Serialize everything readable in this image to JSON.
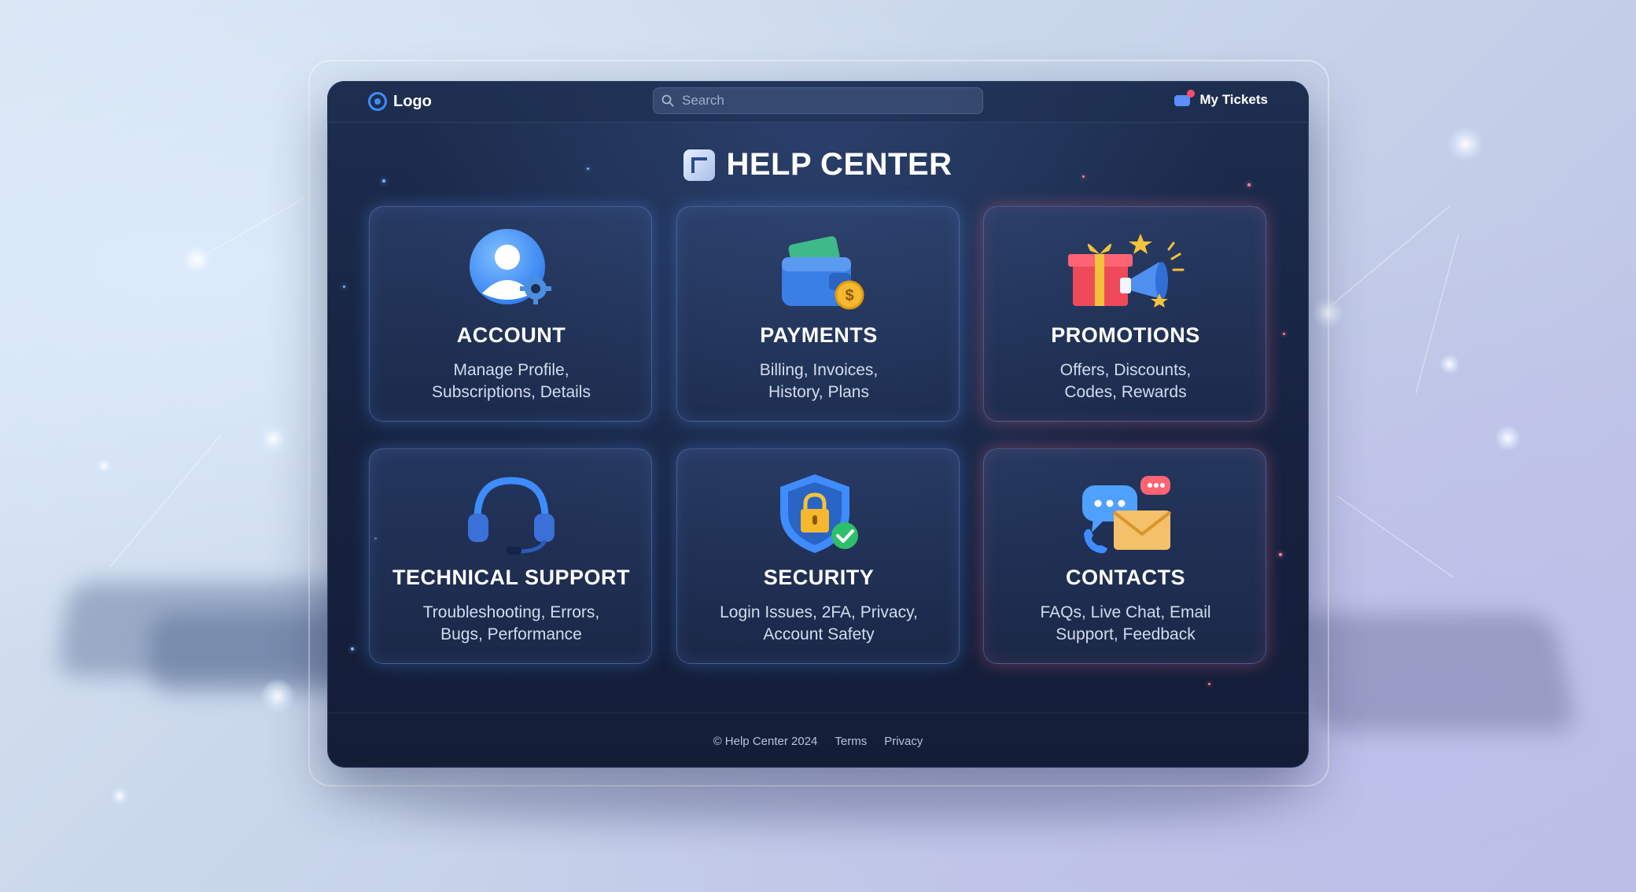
{
  "header": {
    "logo_text": "Logo",
    "search_placeholder": "Search",
    "tickets_label": "My Tickets"
  },
  "page_title": "HELP CENTER",
  "categories": [
    {
      "title": "ACCOUNT",
      "desc_line1": "Manage Profile,",
      "desc_line2": "Subscriptions, Details",
      "icon": "user-gear-icon"
    },
    {
      "title": "PAYMENTS",
      "desc_line1": "Billing, Invoices,",
      "desc_line2": "History, Plans",
      "icon": "wallet-coin-icon"
    },
    {
      "title": "PROMOTIONS",
      "desc_line1": "Offers, Discounts,",
      "desc_line2": "Codes, Rewards",
      "icon": "gift-megaphone-icon"
    },
    {
      "title": "TECHNICAL SUPPORT",
      "desc_line1": "Troubleshooting, Errors,",
      "desc_line2": "Bugs, Performance",
      "icon": "headset-icon"
    },
    {
      "title": "SECURITY",
      "desc_line1": "Login Issues, 2FA, Privacy,",
      "desc_line2": "Account Safety",
      "icon": "shield-lock-icon"
    },
    {
      "title": "CONTACTS",
      "desc_line1": "FAQs, Live Chat, Email",
      "desc_line2": "Support, Feedback",
      "icon": "chat-mail-icon"
    }
  ],
  "footer": {
    "copyright": "© Help Center 2024",
    "terms": "Terms",
    "privacy": "Privacy"
  },
  "colors": {
    "accent_blue": "#3f8cff",
    "accent_pink": "#ff6e96",
    "panel_bg": "#1d2d4f"
  }
}
